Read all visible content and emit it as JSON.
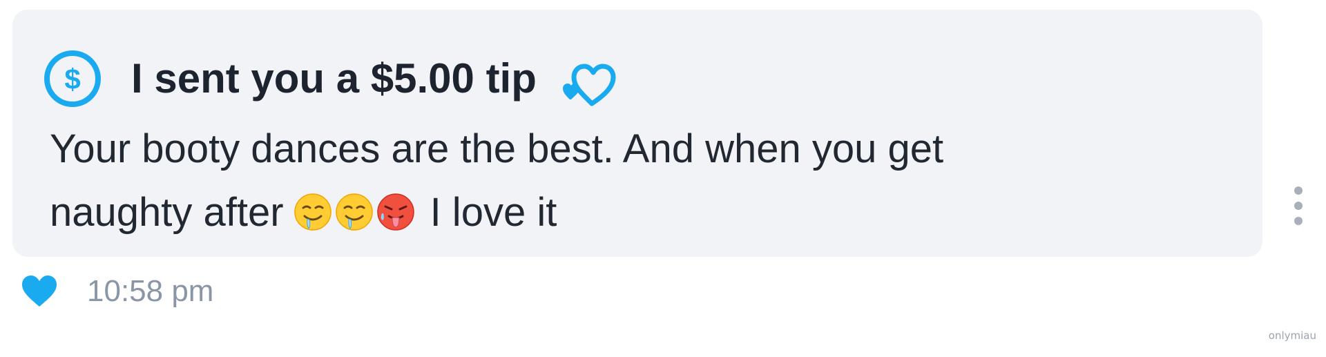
{
  "message": {
    "tip_label": "I sent you a $5.00 tip",
    "text_line1": "Your booty dances are the best. And when you get",
    "text_line2_before": "naughty after",
    "emojis": [
      "drooling-face",
      "drooling-face",
      "hot-face"
    ],
    "text_line2_after": "I love it",
    "time": "10:58 pm"
  },
  "icons": {
    "tip": "dollar-circle-icon",
    "tip_decoration": "hearts-outline-icon",
    "like": "heart-icon",
    "more": "more-vertical-icon"
  },
  "colors": {
    "accent": "#1aaaf0",
    "bubble": "#f1f3f6",
    "text": "#222831",
    "meta_text": "#8a95a5"
  },
  "watermark": "onlymiau"
}
